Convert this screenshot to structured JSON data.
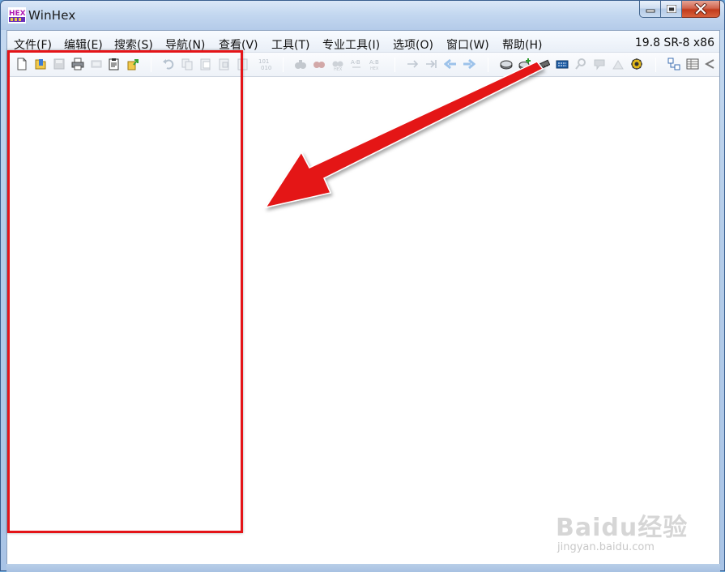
{
  "window": {
    "title": "WinHex",
    "app_icon": "hex-editor-icon"
  },
  "caption_buttons": {
    "minimize": "minimize-icon",
    "maximize": "maximize-icon",
    "close": "close-icon"
  },
  "menu": {
    "items": [
      "文件(F)",
      "编辑(E)",
      "搜索(S)",
      "导航(N)",
      "查看(V)",
      "工具(T)",
      "专业工具(I)",
      "选项(O)",
      "窗口(W)",
      "帮助(H)"
    ],
    "version": "19.8 SR-8 x86"
  },
  "toolbar": {
    "icons": [
      "new-file-icon",
      "open-file-icon",
      "save-icon",
      "print-icon",
      "properties-icon",
      "clipboard-icon",
      "export-icon",
      "undo-icon",
      "copy-icon",
      "paste-icon",
      "paste-write-icon",
      "convert-binary-icon",
      "find-text-icon",
      "find-hex-icon",
      "replace-text-icon",
      "replace-hex-icon",
      "goto-offset-icon",
      "goto-sector-icon",
      "back-icon",
      "forward-icon",
      "open-disk-icon",
      "add-disk-icon",
      "open-ram-icon",
      "calculator-icon",
      "hash-icon",
      "data-interpreter-icon",
      "shell-icon",
      "settings-gear-icon",
      "case-data-icon",
      "details-view-icon",
      "back-arrow-icon"
    ]
  },
  "annotation": {
    "highlight_color": "#e41418",
    "arrow_color": "#e41418"
  },
  "watermark": {
    "logo": "Baidu经验",
    "url": "jingyan.baidu.com"
  },
  "colors": {
    "titlebar": "#c4d8f0",
    "close_button": "#c23b1c",
    "workspace": "#ffffff"
  }
}
